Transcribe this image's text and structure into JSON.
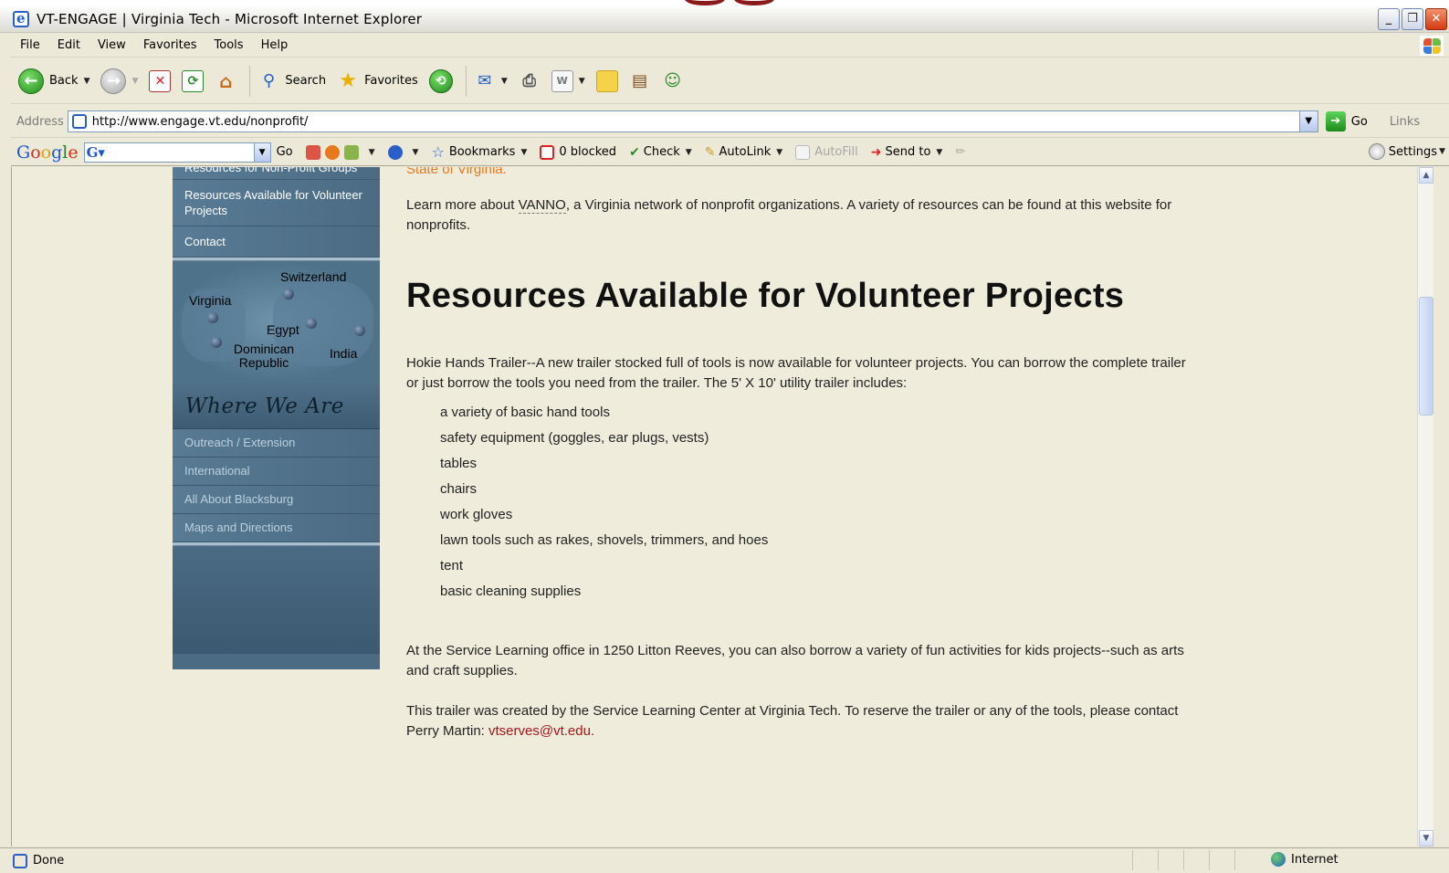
{
  "window": {
    "title": "VT-ENGAGE | Virginia Tech - Microsoft Internet Explorer",
    "buttons": [
      "_",
      "❐",
      "✕"
    ]
  },
  "menu": [
    "File",
    "Edit",
    "View",
    "Favorites",
    "Tools",
    "Help"
  ],
  "toolbar": {
    "back": "Back",
    "search": "Search",
    "favorites": "Favorites"
  },
  "address": {
    "label": "Address",
    "url": "http://www.engage.vt.edu/nonprofit/",
    "go": "Go",
    "links": "Links"
  },
  "googlebar": {
    "go": "Go",
    "bookmarks": "Bookmarks",
    "blocked": "0 blocked",
    "check": "Check",
    "autolink": "AutoLink",
    "autofill": "AutoFill",
    "sendto": "Send to",
    "settings": "Settings"
  },
  "sidebar": {
    "top_links": [
      "Resources for Non-Profit Groups",
      "Resources Available for Volunteer Projects",
      "Contact"
    ],
    "map_labels": {
      "virginia": "Virginia",
      "switzerland": "Switzerland",
      "egypt": "Egypt",
      "dominican": "Dominican Republic",
      "india": "India"
    },
    "where_title": "Where We Are",
    "bottom_links": [
      "Outreach / Extension",
      "International",
      "All About Blacksburg",
      "Maps and Directions"
    ]
  },
  "content": {
    "state_link": "State of Virginia.",
    "vanno_pre": "Learn more about ",
    "vanno": "VANNO",
    "vanno_post": ", a Virginia network of nonprofit organizations. A variety of resources can be found at this website for nonprofits.",
    "heading": "Resources Available for Volunteer Projects",
    "trailer_intro": "Hokie Hands Trailer--A new trailer stocked full of tools is now available for volunteer projects. You can borrow the complete trailer or just borrow the tools you need from the trailer. The 5' X 10' utility trailer includes:",
    "items": [
      "a variety of basic hand tools",
      "safety equipment (goggles, ear plugs, vests)",
      "tables",
      "chairs",
      "work gloves",
      "lawn tools such as rakes, shovels, trimmers, and hoes",
      "tent",
      "basic cleaning supplies"
    ],
    "service_learning": "At the Service Learning office in 1250 Litton Reeves, you can also borrow a variety of fun activities for kids projects--such as arts and craft supplies.",
    "reserve_pre": "This trailer was created by the Service Learning Center at Virginia Tech. To reserve the trailer or any of the tools, please contact Perry Martin: ",
    "email": "vtserves@vt.edu",
    "reserve_post": "."
  },
  "status": {
    "text": "Done",
    "zone": "Internet"
  }
}
